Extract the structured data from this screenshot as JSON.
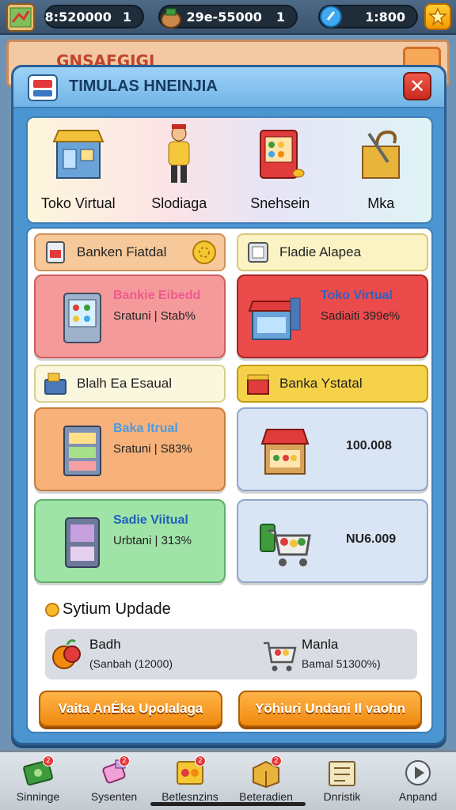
{
  "resources": {
    "cash": "8:520000",
    "cash_badge": "1",
    "goods": "29e-55000",
    "goods_badge": "1",
    "gems": "1:800"
  },
  "background": {
    "banner_title": "GNSAFGIGI"
  },
  "panel": {
    "title": "TIMULAS HNEINJIA",
    "close_label": "✕"
  },
  "categories": [
    {
      "label": "Toko Virtual",
      "icon": "store-icon"
    },
    {
      "label": "Slodiaga",
      "icon": "shopkeeper-icon"
    },
    {
      "label": "Snehsein",
      "icon": "vending-stall-icon"
    },
    {
      "label": "Mka",
      "icon": "tools-box-icon"
    }
  ],
  "sections": {
    "left_top": {
      "title": "Banken Fiatdal"
    },
    "right_top": {
      "title": "Fladie Alapea"
    },
    "left_mid": {
      "title": "Blalh Ea Esaual"
    },
    "right_mid": {
      "title": "Banka Ystatal"
    }
  },
  "cards": [
    {
      "name": "Bankie Eibedd",
      "sub": "Sratuni | Stab%",
      "color": "#ee5b8f"
    },
    {
      "name": "Toko Virtual",
      "sub": "Sadiaiti 399e%",
      "color": "#2b63c4"
    },
    {
      "name": "Baka Itrual",
      "sub": "Sratuni | S83%",
      "color": "#4b9be0"
    },
    {
      "value": "100.008"
    },
    {
      "name": "Sadie Viitual",
      "sub": "Urbtani | 313%",
      "color": "#1f5fbf"
    },
    {
      "value": "NU6.009"
    }
  ],
  "update": {
    "title": "Sytium Updade",
    "items": [
      {
        "name": "Badh",
        "sub": "(Sanbah (12000)"
      },
      {
        "name": "Manla",
        "sub": "Bamal 51300%)"
      }
    ],
    "buttons": [
      {
        "label": "Vaita AnÉka Upolalaga"
      },
      {
        "label": "Yöhiuri Undani Il vaohn"
      }
    ]
  },
  "nav": [
    {
      "label": "Sinninge",
      "icon": "money-icon",
      "badge": "2"
    },
    {
      "label": "Sysenten",
      "icon": "candy-icon",
      "badge": "2"
    },
    {
      "label": "Betlesnzins",
      "icon": "fruit-crate-icon",
      "badge": "2"
    },
    {
      "label": "Beteradien",
      "icon": "box-icon",
      "badge": "2"
    },
    {
      "label": "Dnristik",
      "icon": "chart-book-icon",
      "badge": ""
    },
    {
      "label": "Anpand",
      "icon": "play-icon",
      "badge": ""
    }
  ]
}
